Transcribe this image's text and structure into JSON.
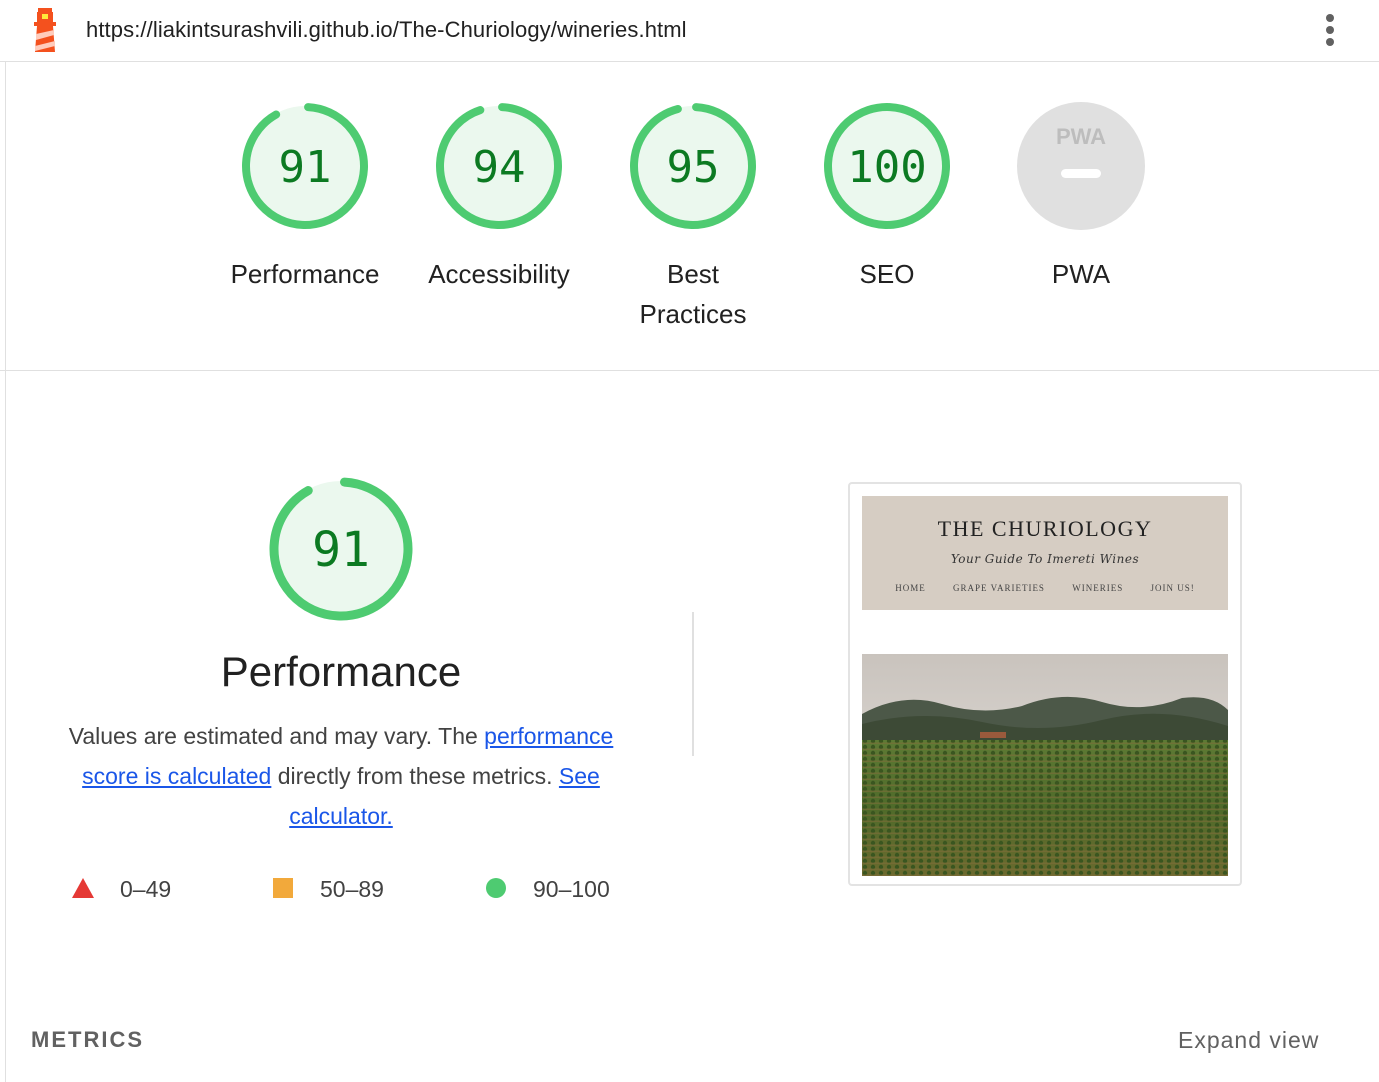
{
  "header": {
    "url": "https://liakintsurashvili.github.io/The-Churiology/wineries.html",
    "logo_icon": "lighthouse-icon",
    "menu_icon": "more-vert-icon"
  },
  "categories": [
    {
      "score": "91",
      "label": "Performance",
      "fraction": 0.91
    },
    {
      "score": "94",
      "label": "Accessibility",
      "fraction": 0.94
    },
    {
      "score": "95",
      "label": "Best Practices",
      "fraction": 0.95
    },
    {
      "score": "100",
      "label": "SEO",
      "fraction": 1.0
    },
    {
      "score": "",
      "label": "PWA",
      "badge": "PWA"
    }
  ],
  "performance": {
    "score": "91",
    "fraction": 0.91,
    "title": "Performance",
    "desc_pre": "Values are estimated and may vary. The ",
    "link1": "performance score is calculated",
    "desc_mid": " directly from these metrics. ",
    "link2": "See calculator."
  },
  "legend": {
    "fail": "0–49",
    "average": "50–89",
    "pass": "90–100"
  },
  "thumbnail": {
    "site_title": "THE CHURIOLOGY",
    "site_subtitle": "Your Guide To Imereti Wines",
    "nav": [
      "HOME",
      "GRAPE VARIETIES",
      "WINERIES",
      "JOIN US!"
    ]
  },
  "footer": {
    "metrics_label": "METRICS",
    "expand_label": "Expand view"
  },
  "colors": {
    "pass": "#0c7a22",
    "pass_ring": "#4ecb71",
    "pass_fill": "#ebf8ee",
    "fail": "#e53935",
    "average": "#f2a93b",
    "pwa_gray": "#e0e0e0",
    "link": "#1a56e8"
  }
}
